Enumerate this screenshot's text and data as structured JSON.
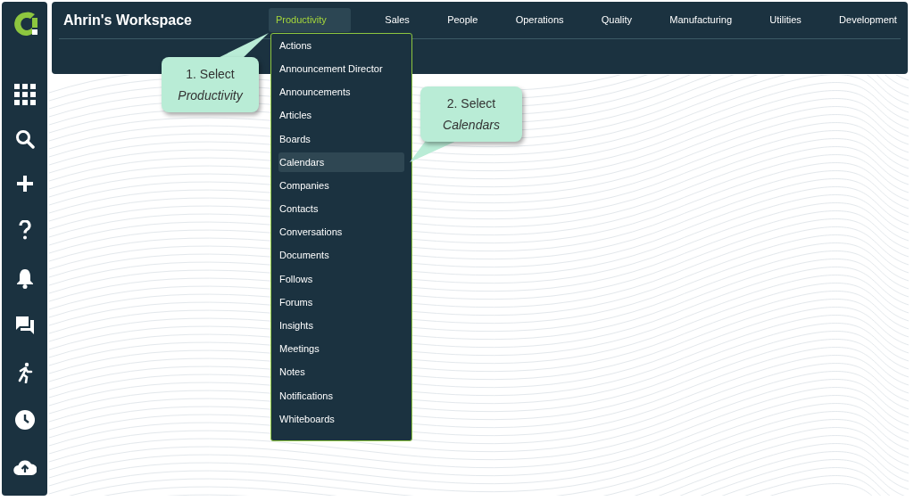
{
  "header": {
    "title": "Ahrin's Workspace"
  },
  "tabs": [
    {
      "label": "Productivity",
      "selected": true
    },
    {
      "label": "Sales",
      "selected": false
    },
    {
      "label": "People",
      "selected": false
    },
    {
      "label": "Operations",
      "selected": false
    },
    {
      "label": "Quality",
      "selected": false
    },
    {
      "label": "Manufacturing",
      "selected": false
    },
    {
      "label": "Utilities",
      "selected": false
    },
    {
      "label": "Development",
      "selected": false
    }
  ],
  "dropdown": {
    "items": [
      {
        "label": "Actions",
        "selected": false
      },
      {
        "label": "Announcement Director",
        "selected": false
      },
      {
        "label": "Announcements",
        "selected": false
      },
      {
        "label": "Articles",
        "selected": false
      },
      {
        "label": "Boards",
        "selected": false
      },
      {
        "label": "Calendars",
        "selected": true
      },
      {
        "label": "Companies",
        "selected": false
      },
      {
        "label": "Contacts",
        "selected": false
      },
      {
        "label": "Conversations",
        "selected": false
      },
      {
        "label": "Documents",
        "selected": false
      },
      {
        "label": "Follows",
        "selected": false
      },
      {
        "label": "Forums",
        "selected": false
      },
      {
        "label": "Insights",
        "selected": false
      },
      {
        "label": "Meetings",
        "selected": false
      },
      {
        "label": "Notes",
        "selected": false
      },
      {
        "label": "Notifications",
        "selected": false
      },
      {
        "label": "Whiteboards",
        "selected": false
      }
    ]
  },
  "callouts": [
    {
      "text": "1. Select *Productivity*"
    },
    {
      "text": "2. Select *Calendars*"
    }
  ]
}
